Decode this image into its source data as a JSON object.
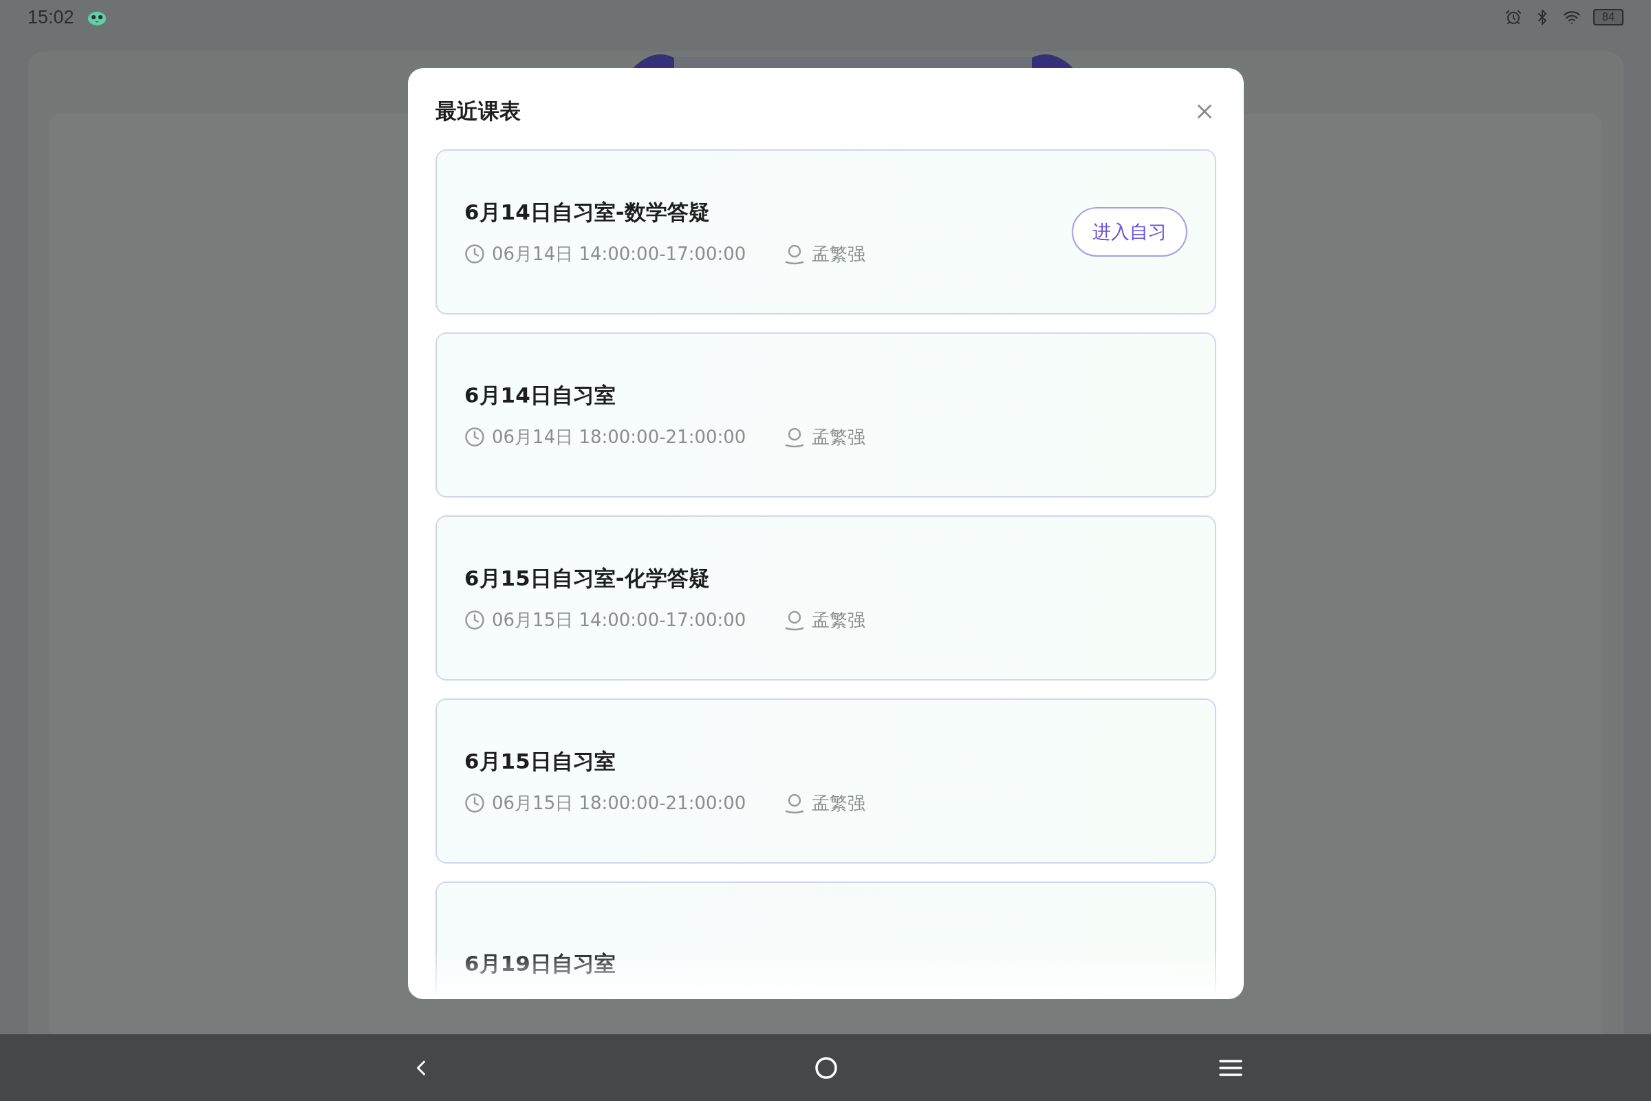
{
  "status_bar": {
    "time": "15:02",
    "battery": "84"
  },
  "dialog": {
    "title": "最近课表",
    "sessions": [
      {
        "title": "6月14日自习室-数学答疑",
        "time": "06月14日 14:00:00-17:00:00",
        "teacher": "孟繁强",
        "action": "进入自习"
      },
      {
        "title": "6月14日自习室",
        "time": "06月14日 18:00:00-21:00:00",
        "teacher": "孟繁强"
      },
      {
        "title": "6月15日自习室-化学答疑",
        "time": "06月15日 14:00:00-17:00:00",
        "teacher": "孟繁强"
      },
      {
        "title": "6月15日自习室",
        "time": "06月15日 18:00:00-21:00:00",
        "teacher": "孟繁强"
      },
      {
        "title": "6月19日自习室"
      }
    ]
  }
}
